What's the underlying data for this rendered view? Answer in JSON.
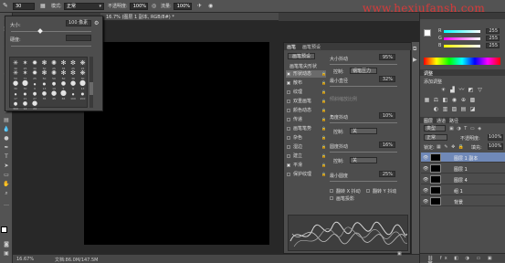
{
  "options_bar": {
    "brush_size": "30",
    "mode_label": "模式:",
    "mode_value": "正常",
    "opacity_label": "不透明度:",
    "opacity_value": "100%",
    "flow_label": "流量:",
    "flow_value": "100%"
  },
  "watermark": "www.hexiufansh.com",
  "document": {
    "tab_title": "16.7% (图层 1 副本, RGB/8#) *",
    "zoom": "16.67%",
    "doc_info": "文档:86.0M/147.5M"
  },
  "brush_picker": {
    "size_label": "大小:",
    "size_value": "100 像素",
    "hardness_label": "硬度:",
    "brush_sizes": [
      "30",
      "25",
      "30",
      "50",
      "25",
      "35",
      "25",
      "25",
      "50",
      "71",
      "25",
      "50",
      "50",
      "50",
      "36",
      "30",
      "30",
      "30",
      "9",
      "13",
      "19",
      "5",
      "9",
      "13",
      "17",
      "21",
      "27",
      "35",
      "45",
      "65",
      "100",
      "200",
      "300",
      "14",
      "24"
    ]
  },
  "brush_panel": {
    "tabs": [
      "画笔",
      "画笔预设"
    ],
    "preset_button": "画笔预设",
    "tip_header": "画笔笔尖形状",
    "list": [
      {
        "label": "形状动态",
        "checked": true,
        "selected": true
      },
      {
        "label": "散布",
        "checked": true,
        "selected": false
      },
      {
        "label": "纹理",
        "checked": false,
        "selected": false
      },
      {
        "label": "双重画笔",
        "checked": false,
        "selected": false
      },
      {
        "label": "颜色动态",
        "checked": false,
        "selected": false
      },
      {
        "label": "传递",
        "checked": false,
        "selected": false
      },
      {
        "label": "画笔笔势",
        "checked": false,
        "selected": false
      },
      {
        "label": "杂色",
        "checked": false,
        "selected": false
      },
      {
        "label": "湿边",
        "checked": false,
        "selected": false
      },
      {
        "label": "建立",
        "checked": false,
        "selected": false
      },
      {
        "label": "平滑",
        "checked": true,
        "selected": false
      },
      {
        "label": "保护纹理",
        "checked": false,
        "selected": false
      }
    ],
    "params": {
      "size_jitter_label": "大小抖动",
      "size_jitter_value": "95%",
      "control_label": "控制:",
      "control_value": "钢笔压力",
      "min_diameter_label": "最小直径",
      "min_diameter_value": "32%",
      "tilt_scale_label": "倾斜缩放比例",
      "angle_jitter_label": "角度抖动",
      "angle_jitter_value": "10%",
      "control2_label": "控制:",
      "control2_value": "关",
      "roundness_jitter_label": "圆度抖动",
      "roundness_jitter_value": "16%",
      "control3_label": "控制:",
      "control3_value": "关",
      "min_roundness_label": "最小圆度",
      "min_roundness_value": "25%",
      "flip_x_label": "翻转 X 抖动",
      "flip_y_label": "翻转 Y 抖动",
      "brush_projection_label": "画笔投影"
    }
  },
  "color_panel": {
    "r_label": "R",
    "r_value": "255",
    "g_label": "G",
    "g_value": "255",
    "b_label": "B",
    "b_value": "255"
  },
  "adjustments_panel": {
    "tab": "调整",
    "title": "添加调整"
  },
  "layers_panel": {
    "tabs": [
      "图层",
      "通道",
      "路径"
    ],
    "filter_label": "类型",
    "blend_mode": "正常",
    "opacity_label": "不透明度:",
    "opacity_value": "100%",
    "lock_label": "锁定:",
    "fill_label": "填充:",
    "fill_value": "100%",
    "layers": [
      {
        "name": "图层 1 副本",
        "selected": true
      },
      {
        "name": "图层 1",
        "selected": false
      },
      {
        "name": "图层 4",
        "selected": false
      },
      {
        "name": "组 1",
        "selected": false
      },
      {
        "name": "背景",
        "selected": false
      }
    ]
  }
}
